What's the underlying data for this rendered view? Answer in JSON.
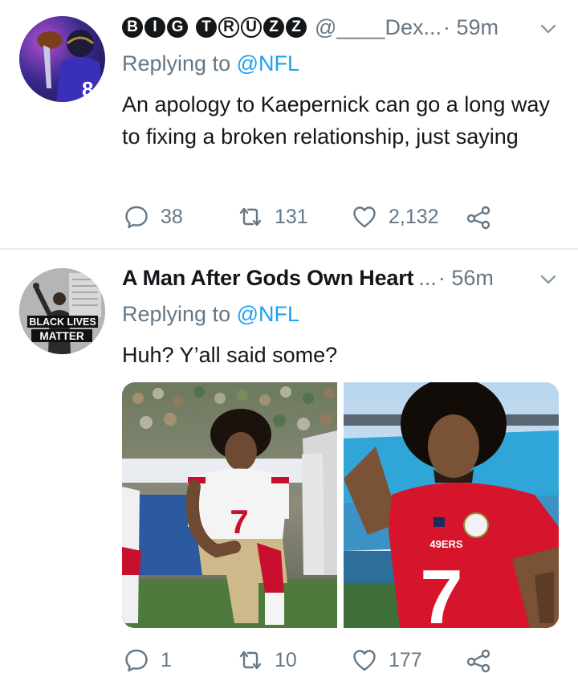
{
  "tweets": [
    {
      "display_name_letters": [
        "B",
        "I",
        "G",
        "T",
        "R",
        "U",
        "Z",
        "Z"
      ],
      "handle": "@____Dex...",
      "time": "· 59m",
      "replying_prefix": "Replying to ",
      "replying_to": "@NFL",
      "text": "An apology to Kaepernick can go a long way to fixing a broken relationship, just saying",
      "actions": {
        "replies": "38",
        "retweets": "131",
        "likes": "2,132"
      }
    },
    {
      "display_name": "A Man After Gods Own Heart",
      "handle": "...",
      "time": "· 56m",
      "replying_prefix": "Replying to ",
      "replying_to": "@NFL",
      "text": "Huh? Y’all said some?",
      "avatar_text": {
        "line1": "BLACK LIVES",
        "line2": "MATTER"
      },
      "photo1": {
        "jersey_number": "7"
      },
      "photo2": {
        "jersey_number": "7",
        "chest_text": "49ERS"
      },
      "actions": {
        "replies": "1",
        "retweets": "10",
        "likes": "177"
      }
    }
  ],
  "icons": [
    "chevron-down-icon",
    "reply-icon",
    "retweet-icon",
    "like-icon",
    "share-icon"
  ],
  "colors": {
    "accent": "#1da1f2",
    "secondary_text": "#657786",
    "primary_text": "#14171a"
  }
}
